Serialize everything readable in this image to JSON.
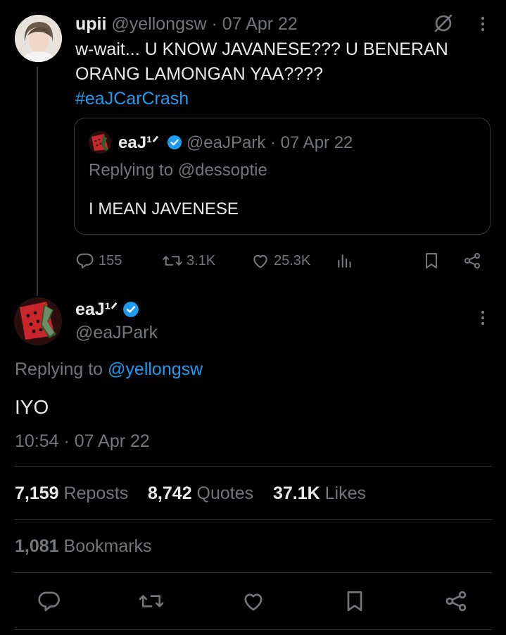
{
  "quoted_thread_tweet": {
    "author_name": "upii",
    "author_handle": "@yellongsw",
    "separator": " · ",
    "date": "07 Apr 22",
    "text": "w-wait... U KNOW JAVANESE??? U BENERAN ORANG LAMONGAN YAA????",
    "hashtag": "#eaJCarCrash",
    "embedded_quote": {
      "author_name": "eaJ¹ᐟ",
      "author_handle": "@eaJPark",
      "date": "07 Apr 22",
      "replying_prefix": "Replying to ",
      "replying_to": "@dessoptie",
      "text": "I MEAN JAVENESE"
    },
    "actions": {
      "replies": "155",
      "reposts": "3.1K",
      "likes": "25.3K"
    }
  },
  "main_tweet": {
    "author_name": "eaJ¹ᐟ",
    "author_handle": "@eaJPark",
    "replying_prefix": "Replying to ",
    "replying_to": "@yellongsw",
    "text": "IYO",
    "timestamp": "10:54 · 07 Apr 22",
    "stats": {
      "reposts_count": "7,159",
      "reposts_label": "Reposts",
      "quotes_count": "8,742",
      "quotes_label": "Quotes",
      "likes_count": "37.1K",
      "likes_label": "Likes",
      "bookmarks_count": "1,081",
      "bookmarks_label": "Bookmarks"
    }
  },
  "icons": {
    "reply": "reply-icon",
    "repost": "repost-icon",
    "like": "heart-icon",
    "views": "analytics-icon",
    "bookmark": "bookmark-icon",
    "share": "share-icon",
    "more": "more-dots-icon",
    "grok": "grok-icon",
    "verified": "verified-badge-icon"
  },
  "colors": {
    "background": "#000000",
    "text": "#e7e9ea",
    "muted": "#71767b",
    "accent": "#1d9bf0",
    "border": "#2f3336"
  }
}
